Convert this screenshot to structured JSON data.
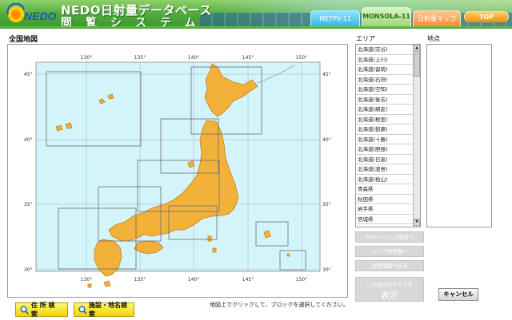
{
  "header": {
    "logo_text": "NEDO",
    "title_line1": "NEDO日射量データベース",
    "title_line2": "閲覧システム",
    "tabs": [
      {
        "label": "METPV-11"
      },
      {
        "label": "MONSOLA-11"
      },
      {
        "label": "日射量マップ"
      },
      {
        "label": "TOP"
      }
    ]
  },
  "map": {
    "title": "全国地図",
    "lon_labels": [
      "130°",
      "135°",
      "140°",
      "145°",
      "150°"
    ],
    "lat_labels": [
      "45°",
      "40°",
      "35°",
      "30°"
    ],
    "hint": "地図上でクリックして、ブロックを選択してください。",
    "colors": {
      "sea": "#d4f4fb",
      "land": "#f0a41e",
      "grid": "#9aa0a6"
    }
  },
  "search": {
    "address_label": "住 所 検 索",
    "facility_label": "施設・地名検索"
  },
  "area": {
    "label": "エリア",
    "items": [
      "北海道(宗谷)",
      "北海道(上川)",
      "北海道(留萌)",
      "北海道(石狩)",
      "北海道(空知)",
      "北海道(後志)",
      "北海道(網走)",
      "北海道(根室)",
      "北海道(釧路)",
      "北海道(十勝)",
      "北海道(胆振)",
      "北海道(日高)",
      "北海道(渡島)",
      "北海道(桧山)",
      "青森県",
      "秋田県",
      "岩手県",
      "宮城県"
    ]
  },
  "point": {
    "label": "地点"
  },
  "buttons": {
    "mesh_map": "1kmメッシュ地図へ",
    "area_map": "エリア別地図へ",
    "back_to_national": "全国地図へ戻る",
    "graph_small": "この地点のグラフを",
    "graph_big": "表示",
    "cancel": "キャンセル"
  }
}
